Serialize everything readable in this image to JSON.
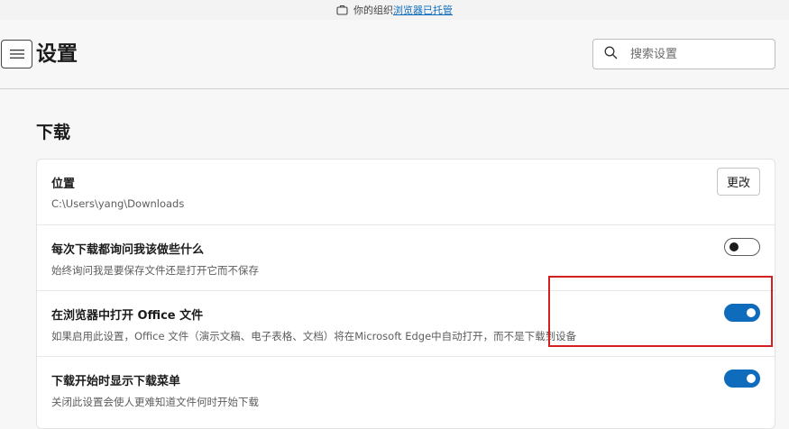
{
  "banner": {
    "prefix": "你的组织",
    "link": "浏览器已托管",
    "icon": "briefcase-icon"
  },
  "header": {
    "menu_icon": "hamburger-menu-icon",
    "title": "设置",
    "search": {
      "placeholder": "搜索设置",
      "value": "",
      "icon": "search-icon"
    }
  },
  "section": {
    "title": "下载"
  },
  "settings": [
    {
      "title": "位置",
      "description": "C:\\Users\\yang\\Downloads",
      "control": "button",
      "button_label": "更改"
    },
    {
      "title": "每次下载都询问我该做些什么",
      "description": "始终询问我是要保存文件还是打开它而不保存",
      "control": "toggle",
      "state": "off"
    },
    {
      "title": "在浏览器中打开 Office 文件",
      "description": "如果启用此设置，Office 文件（演示文稿、电子表格、文档）将在Microsoft Edge中自动打开，而不是下载到设备",
      "control": "toggle",
      "state": "on"
    },
    {
      "title": "下载开始时显示下载菜单",
      "description": "关闭此设置会使人更难知道文件何时开始下载",
      "control": "toggle",
      "state": "on"
    }
  ],
  "colors": {
    "accent": "#0f6cbd",
    "highlight": "#d21f1f"
  }
}
